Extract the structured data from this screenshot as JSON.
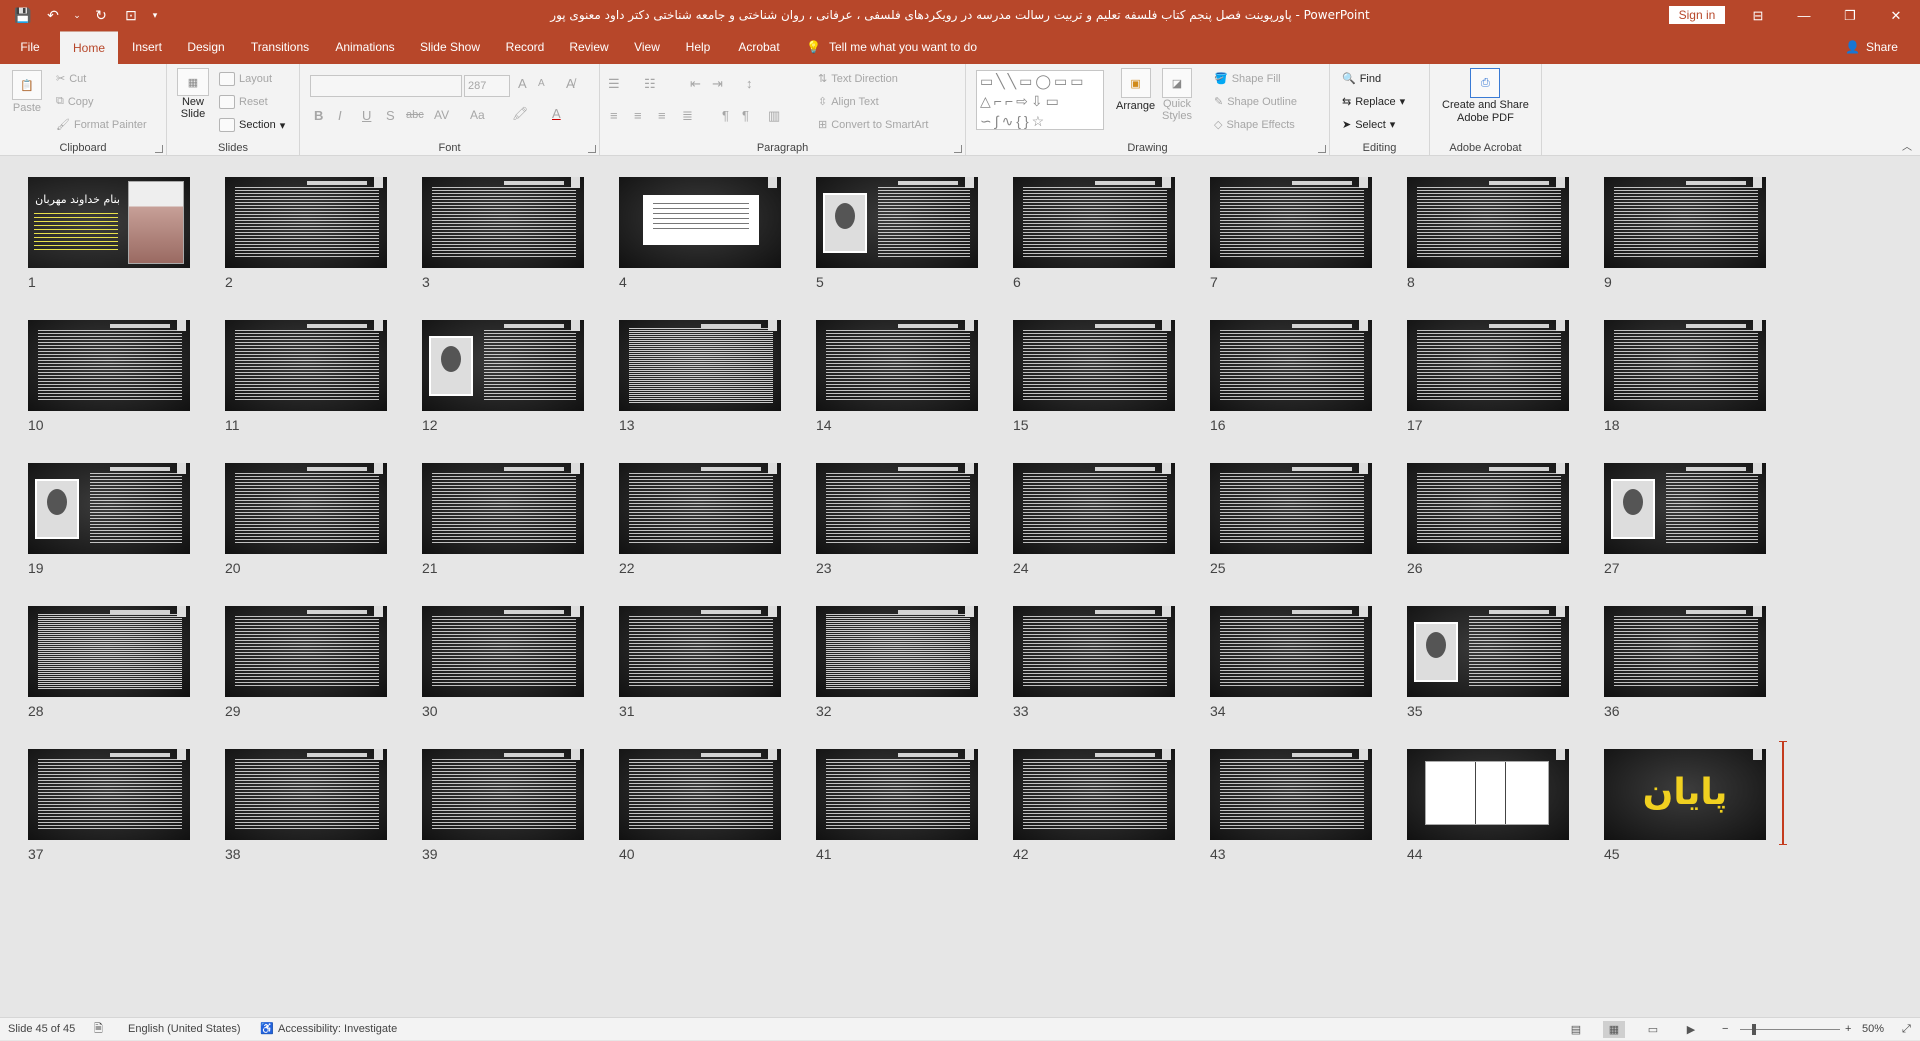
{
  "titlebar": {
    "title": "پاورپوینت فصل پنجم کتاب فلسفه تعلیم و تربیت رسالت مدرسه در رویکردهای فلسفی ، عرفانی ، روان شناختی و جامعه شناختی دکتر داود معنوی پور  -  PowerPoint",
    "sign_in": "Sign in",
    "qat": {
      "save": "💾",
      "undo": "↶",
      "undo_more": "⌄",
      "redo": "↻",
      "present": "⊡",
      "customize": "▾"
    },
    "window": {
      "ribbon_options": "⊟",
      "minimize": "—",
      "restore": "❐",
      "close": "✕"
    }
  },
  "tabs": [
    "File",
    "Home",
    "Insert",
    "Design",
    "Transitions",
    "Animations",
    "Slide Show",
    "Record",
    "Review",
    "View",
    "Help",
    "Acrobat"
  ],
  "active_tab": "Home",
  "tell_me": {
    "icon": "lightbulb-icon",
    "text": "Tell me what you want to do"
  },
  "share": {
    "icon": "person-icon",
    "label": "Share"
  },
  "ribbon": {
    "clipboard": {
      "label": "Clipboard",
      "paste": "Paste",
      "cut": "Cut",
      "copy": "Copy",
      "format_painter": "Format Painter"
    },
    "slides": {
      "label": "Slides",
      "new_slide_1": "New",
      "new_slide_2": "Slide",
      "layout": "Layout",
      "reset": "Reset",
      "section": "Section"
    },
    "font": {
      "label": "Font",
      "font_name": "",
      "font_size": "287",
      "bold": "B",
      "italic": "I",
      "underline": "U",
      "shadow": "S",
      "strike": "abc",
      "spacing": "AV",
      "case": "Aa",
      "grow": "A",
      "shrink": "A"
    },
    "paragraph": {
      "label": "Paragraph",
      "text_direction": "Text Direction",
      "align_text": "Align Text",
      "convert_smartart": "Convert to SmartArt"
    },
    "drawing": {
      "label": "Drawing",
      "arrange": "Arrange",
      "quick_styles_1": "Quick",
      "quick_styles_2": "Styles",
      "shape_fill": "Shape Fill",
      "shape_outline": "Shape Outline",
      "shape_effects": "Shape Effects",
      "shapes_glyphs": "▭╲╲▭◯▭▭ △⌐⌐⇨⇩▭ ∽∫∿{}☆"
    },
    "editing": {
      "label": "Editing",
      "find": "Find",
      "replace": "Replace",
      "select": "Select"
    },
    "acrobat": {
      "label": "Adobe Acrobat",
      "create_1": "Create and Share",
      "create_2": "Adobe PDF"
    }
  },
  "slides": [
    {
      "n": "1",
      "kind": "title",
      "title_text": "بنام خداوند مهربان"
    },
    {
      "n": "2",
      "kind": "text"
    },
    {
      "n": "3",
      "kind": "text"
    },
    {
      "n": "4",
      "kind": "doc"
    },
    {
      "n": "5",
      "kind": "photo"
    },
    {
      "n": "6",
      "kind": "text"
    },
    {
      "n": "7",
      "kind": "text"
    },
    {
      "n": "8",
      "kind": "text"
    },
    {
      "n": "9",
      "kind": "text"
    },
    {
      "n": "10",
      "kind": "text"
    },
    {
      "n": "11",
      "kind": "text"
    },
    {
      "n": "12",
      "kind": "photo"
    },
    {
      "n": "13",
      "kind": "dense"
    },
    {
      "n": "14",
      "kind": "text"
    },
    {
      "n": "15",
      "kind": "text"
    },
    {
      "n": "16",
      "kind": "text"
    },
    {
      "n": "17",
      "kind": "text"
    },
    {
      "n": "18",
      "kind": "text"
    },
    {
      "n": "19",
      "kind": "photo"
    },
    {
      "n": "20",
      "kind": "text"
    },
    {
      "n": "21",
      "kind": "text"
    },
    {
      "n": "22",
      "kind": "text"
    },
    {
      "n": "23",
      "kind": "text"
    },
    {
      "n": "24",
      "kind": "text"
    },
    {
      "n": "25",
      "kind": "text"
    },
    {
      "n": "26",
      "kind": "text"
    },
    {
      "n": "27",
      "kind": "photo"
    },
    {
      "n": "28",
      "kind": "dense"
    },
    {
      "n": "29",
      "kind": "text"
    },
    {
      "n": "30",
      "kind": "text"
    },
    {
      "n": "31",
      "kind": "text"
    },
    {
      "n": "32",
      "kind": "dense"
    },
    {
      "n": "33",
      "kind": "text"
    },
    {
      "n": "34",
      "kind": "text"
    },
    {
      "n": "35",
      "kind": "photo"
    },
    {
      "n": "36",
      "kind": "text"
    },
    {
      "n": "37",
      "kind": "text"
    },
    {
      "n": "38",
      "kind": "text"
    },
    {
      "n": "39",
      "kind": "text"
    },
    {
      "n": "40",
      "kind": "text"
    },
    {
      "n": "41",
      "kind": "text"
    },
    {
      "n": "42",
      "kind": "text"
    },
    {
      "n": "43",
      "kind": "text"
    },
    {
      "n": "44",
      "kind": "table"
    },
    {
      "n": "45",
      "kind": "end",
      "end_text": "پایان"
    }
  ],
  "status": {
    "slide_count": "Slide 45 of 45",
    "language": "English (United States)",
    "accessibility": "Accessibility: Investigate",
    "zoom": "50%",
    "zoom_minus": "−",
    "zoom_plus": "+"
  }
}
